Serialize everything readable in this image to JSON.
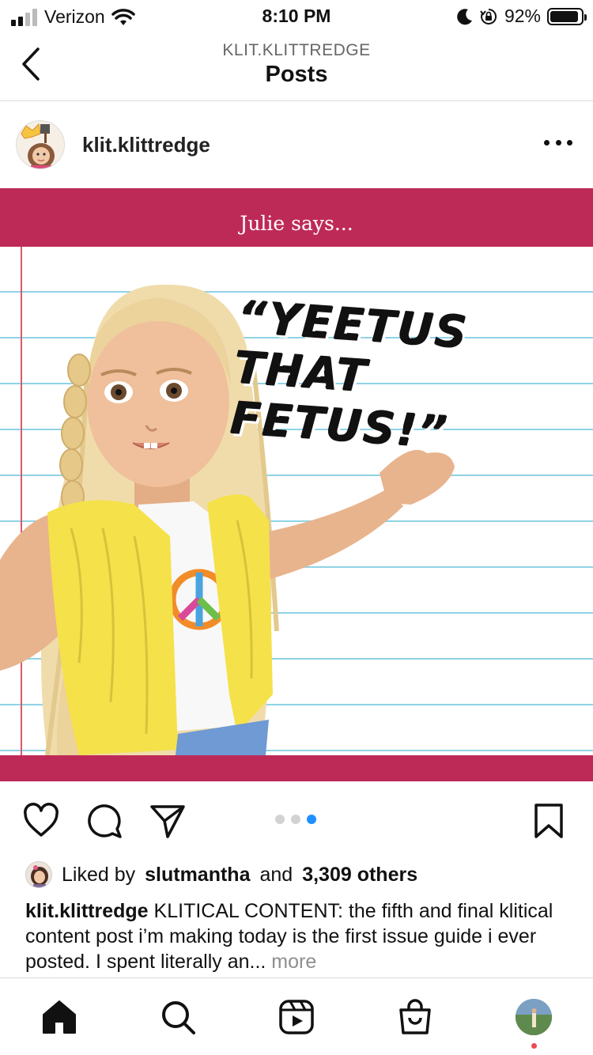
{
  "status_bar": {
    "carrier": "Verizon",
    "time": "8:10 PM",
    "battery_percent": "92%",
    "battery_level": 0.92,
    "icons": [
      "signal-icon",
      "wifi-icon",
      "moon-icon",
      "orientation-lock-icon",
      "battery-icon"
    ]
  },
  "header": {
    "subtitle": "KLIT.KLITTREDGE",
    "title": "Posts",
    "back_icon": "chevron-left-icon"
  },
  "post": {
    "username": "klit.klittredge",
    "more_icon": "more-options-icon",
    "image": {
      "banner_text": "Julie says...",
      "quote": "“YEETUS THAT FETUS!”",
      "colors": {
        "banner": "#be2a58",
        "rule_lines": "#8fd3e6",
        "margin_line": "#d65a6a"
      }
    },
    "carousel": {
      "count": 3,
      "active_index": 2
    },
    "likes": {
      "prefix": "Liked by",
      "user": "slutmantha",
      "connector": "and",
      "others": "3,309 others"
    },
    "caption": {
      "username": "klit.klittredge",
      "text": "KLITICAL CONTENT: the fifth and final klitical content post i’m making today is the first issue guide i ever posted. I spent literally an...",
      "more": "more"
    }
  },
  "actions": {
    "icons": [
      "heart-icon",
      "comment-icon",
      "share-icon",
      "bookmark-icon"
    ]
  },
  "tab_bar": {
    "icons": [
      "home-icon",
      "search-icon",
      "reels-icon",
      "shop-icon",
      "profile-avatar"
    ]
  }
}
